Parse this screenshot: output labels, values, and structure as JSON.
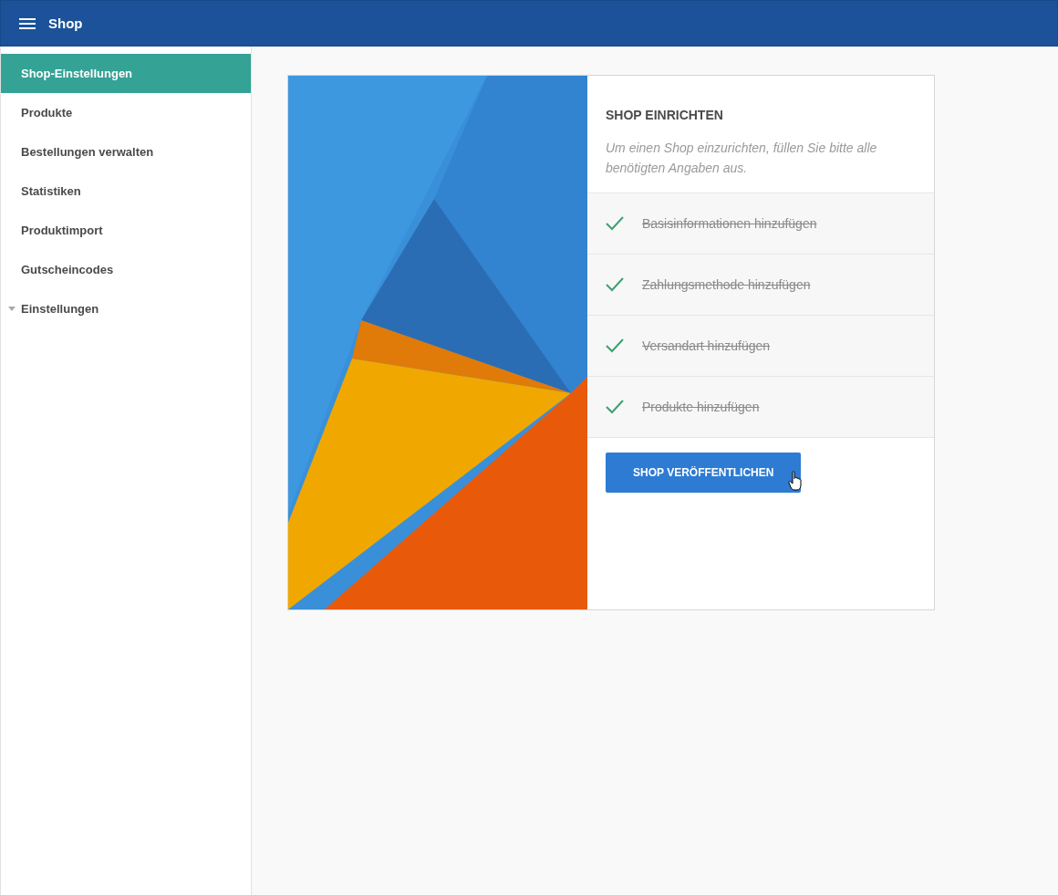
{
  "app_bar": {
    "title": "Shop"
  },
  "sidebar": {
    "items": [
      {
        "label": "Shop-Einstellungen",
        "selected": true
      },
      {
        "label": "Produkte",
        "selected": false
      },
      {
        "label": "Bestellungen verwalten",
        "selected": false
      },
      {
        "label": "Statistiken",
        "selected": false
      },
      {
        "label": "Produktimport",
        "selected": false
      },
      {
        "label": "Gutscheincodes",
        "selected": false
      },
      {
        "label": "Einstellungen",
        "selected": false,
        "expanded": false
      }
    ]
  },
  "setup_card": {
    "title": "SHOP EINRICHTEN",
    "description": "Um einen Shop einzurichten, füllen Sie bitte alle benötigten Angaben aus.",
    "steps": [
      {
        "label": "Basisinformationen hinzufügen",
        "done": true
      },
      {
        "label": "Zahlungsmethode hinzufügen",
        "done": true
      },
      {
        "label": "Versandart hinzufügen",
        "done": true
      },
      {
        "label": "Produkte hinzufügen",
        "done": true
      }
    ],
    "button": "SHOP VERÖFFENTLICHEN"
  }
}
